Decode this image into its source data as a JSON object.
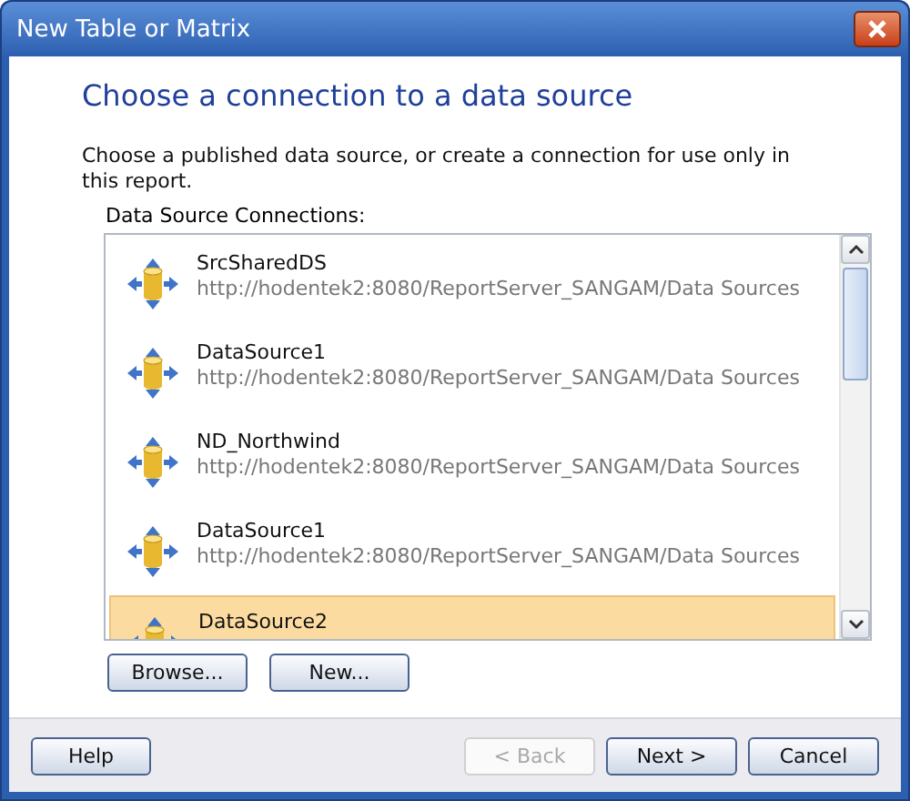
{
  "window": {
    "title": "New Table or Matrix"
  },
  "heading": "Choose a connection to a data source",
  "description": "Choose a published data source, or create a connection for use only in this report.",
  "list_label": "Data Source Connections:",
  "connections": [
    {
      "name": "SrcSharedDS",
      "path": "http://hodentek2:8080/ReportServer_SANGAM/Data Sources",
      "selected": false
    },
    {
      "name": "DataSource1",
      "path": "http://hodentek2:8080/ReportServer_SANGAM/Data Sources",
      "selected": false
    },
    {
      "name": "ND_Northwind",
      "path": "http://hodentek2:8080/ReportServer_SANGAM/Data Sources",
      "selected": false
    },
    {
      "name": "DataSource1",
      "path": "http://hodentek2:8080/ReportServer_SANGAM/Data Sources",
      "selected": false
    },
    {
      "name": "DataSource2",
      "selected": true
    }
  ],
  "list_buttons": [
    "Browse...",
    "New..."
  ],
  "footer_buttons": [
    {
      "label": "Help",
      "disabled": false
    },
    {
      "label": "< Back",
      "disabled": true
    },
    {
      "label": "Next >",
      "disabled": false
    },
    {
      "label": "Cancel",
      "disabled": false
    }
  ]
}
